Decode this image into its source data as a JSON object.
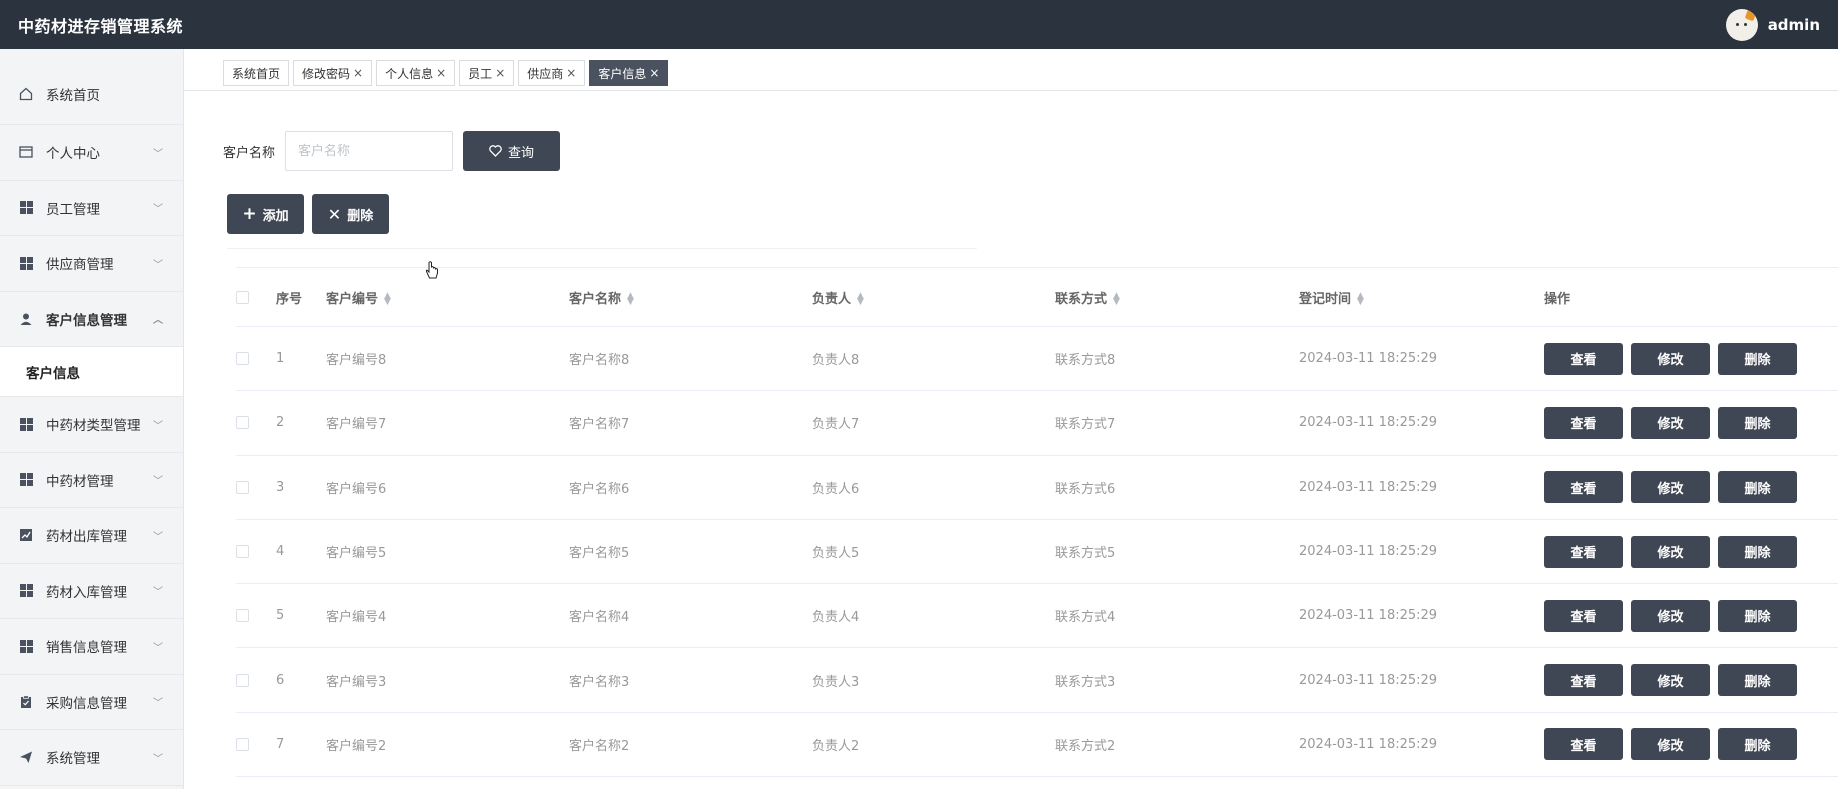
{
  "header": {
    "title": "中药材进存销管理系统",
    "username": "admin"
  },
  "sidebar": {
    "items": [
      {
        "label": "系统首页",
        "icon": "home-icon"
      },
      {
        "label": "个人中心",
        "icon": "card-icon"
      },
      {
        "label": "员工管理",
        "icon": "grid-icon"
      },
      {
        "label": "供应商管理",
        "icon": "grid-icon"
      },
      {
        "label": "客户信息管理",
        "icon": "user-icon"
      },
      {
        "label": "客户信息",
        "icon": ""
      },
      {
        "label": "中药材类型管理",
        "icon": "grid-icon"
      },
      {
        "label": "中药材管理",
        "icon": "grid-icon"
      },
      {
        "label": "药材出库管理",
        "icon": "chart-icon"
      },
      {
        "label": "药材入库管理",
        "icon": "grid-icon"
      },
      {
        "label": "销售信息管理",
        "icon": "grid-icon"
      },
      {
        "label": "采购信息管理",
        "icon": "clipboard-icon"
      },
      {
        "label": "系统管理",
        "icon": "send-icon"
      }
    ]
  },
  "tabs": [
    {
      "label": "系统首页",
      "closable": false
    },
    {
      "label": "修改密码",
      "closable": true
    },
    {
      "label": "个人信息",
      "closable": true
    },
    {
      "label": "员工",
      "closable": true
    },
    {
      "label": "供应商",
      "closable": true
    },
    {
      "label": "客户信息",
      "closable": true
    }
  ],
  "search": {
    "label": "客户名称",
    "placeholder": "客户名称",
    "button": "查询"
  },
  "actions": {
    "add": "添加",
    "delete": "删除"
  },
  "table": {
    "headers": [
      "序号",
      "客户编号",
      "客户名称",
      "负责人",
      "联系方式",
      "登记时间",
      "操作"
    ],
    "rows": [
      [
        "1",
        "客户编号8",
        "客户名称8",
        "负责人8",
        "联系方式8",
        "2024-03-11 18:25:29"
      ],
      [
        "2",
        "客户编号7",
        "客户名称7",
        "负责人7",
        "联系方式7",
        "2024-03-11 18:25:29"
      ],
      [
        "3",
        "客户编号6",
        "客户名称6",
        "负责人6",
        "联系方式6",
        "2024-03-11 18:25:29"
      ],
      [
        "4",
        "客户编号5",
        "客户名称5",
        "负责人5",
        "联系方式5",
        "2024-03-11 18:25:29"
      ],
      [
        "5",
        "客户编号4",
        "客户名称4",
        "负责人4",
        "联系方式4",
        "2024-03-11 18:25:29"
      ],
      [
        "6",
        "客户编号3",
        "客户名称3",
        "负责人3",
        "联系方式3",
        "2024-03-11 18:25:29"
      ],
      [
        "7",
        "客户编号2",
        "客户名称2",
        "负责人2",
        "联系方式2",
        "2024-03-11 18:25:29"
      ]
    ],
    "row_buttons": {
      "view": "查看",
      "edit": "修改",
      "delete": "删除"
    }
  },
  "colors": {
    "topbar": "#2b333e",
    "button": "#3f4754",
    "active_tab": "#4a5260"
  }
}
